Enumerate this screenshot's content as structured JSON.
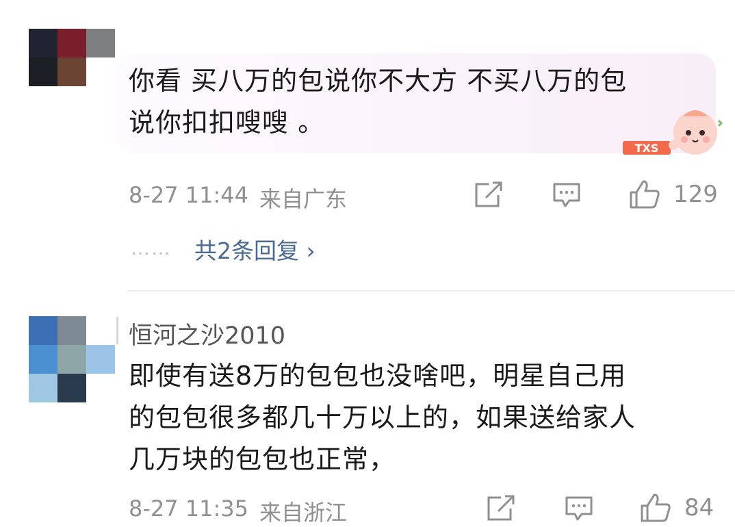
{
  "comments": [
    {
      "text": "你看 买八万的包说你不大方 不买八万的包\n说你扣扣嗖嗖 。",
      "timestamp": "8-27 11:44",
      "location": "来自广东",
      "like_count": "129",
      "replies_link": "共2条回复 ›",
      "replies_dots": "……",
      "sticker_label": "TXS"
    },
    {
      "username": "恒河之沙2010",
      "text": "即使有送8万的包包也没啥吧，明星自己用\n的包包很多都几十万以上的，如果送给家人\n几万块的包包也正常，",
      "timestamp": "8-27 11:35",
      "location": "来自浙江",
      "like_count": "84"
    }
  ],
  "icons": {
    "share": "share-icon",
    "comment": "comment-icon",
    "like": "thumbs-up-icon"
  },
  "colors": {
    "meta_gray": "#8f8f8f",
    "link_blue": "#4a6a94",
    "bubble_tint": "#f8eef8"
  }
}
